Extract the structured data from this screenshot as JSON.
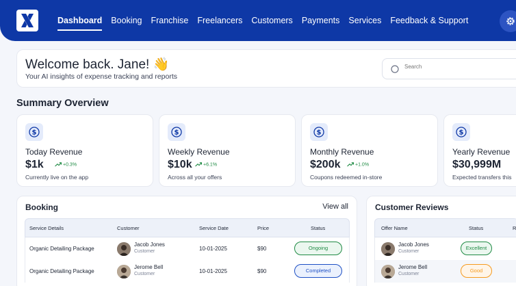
{
  "nav": {
    "items": [
      "Dashboard",
      "Booking",
      "Franchise",
      "Freelancers",
      "Customers",
      "Payments",
      "Services",
      "Feedback & Support"
    ],
    "active": "Dashboard"
  },
  "welcome": {
    "title": "Welcome back. Jane! 👋",
    "subtitle": "Your AI insights of expense tracking and reports"
  },
  "search": {
    "placeholder": "Search"
  },
  "summary": {
    "title": "Summary Overview",
    "cards": [
      {
        "label": "Today Revenue",
        "value": "$1k",
        "trend": "+0.3%",
        "note": "Currently live on the app"
      },
      {
        "label": "Weekly Revenue",
        "value": "$10k",
        "trend": "+6.1%",
        "note": "Across all your offers"
      },
      {
        "label": "Monthly Revenue",
        "value": "$200k",
        "trend": "+1.0%",
        "note": "Coupons redeemed in-store"
      },
      {
        "label": "Yearly Revenue",
        "value": "$30,999M",
        "trend": "",
        "note": "Expected transfers this"
      }
    ]
  },
  "booking": {
    "title": "Booking",
    "view_all": "View all",
    "columns": [
      "Service Details",
      "Customer",
      "Service Date",
      "Price",
      "Status"
    ],
    "rows": [
      {
        "service": "Organic Detailing Package",
        "name": "Jacob Jones",
        "role": "Customer",
        "date": "10-01-2025",
        "price": "$90",
        "status": "Ongoing"
      },
      {
        "service": "Organic Detailing Package",
        "name": "Jerome Bell",
        "role": "Customer",
        "date": "10-01-2025",
        "price": "$90",
        "status": "Completed"
      }
    ]
  },
  "reviews": {
    "title": "Customer Reviews",
    "columns": [
      "Offer Name",
      "Status",
      "Ra"
    ],
    "rows": [
      {
        "name": "Jacob Jones",
        "role": "Customer",
        "status": "Excellent"
      },
      {
        "name": "Jerome Bell",
        "role": "Customer",
        "status": "Good"
      }
    ]
  },
  "colors": {
    "primary": "#0e38a6",
    "positive": "#1e8a43",
    "ongoing": "#1e8a43",
    "completed": "#1d4fc4",
    "excellent": "#1e8a43",
    "good": "#f59a1e"
  }
}
